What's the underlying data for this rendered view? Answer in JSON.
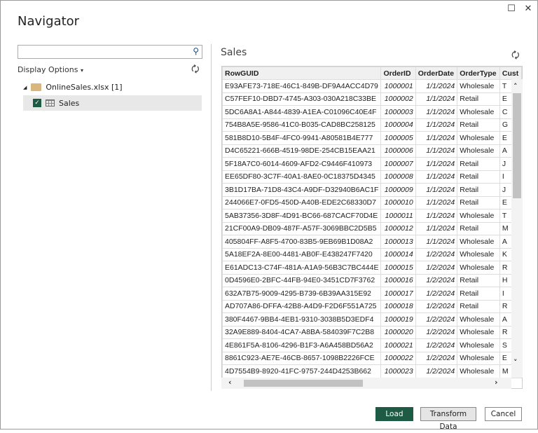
{
  "window": {
    "title": "Navigator",
    "maximize_icon": "☐",
    "close_icon": "✕"
  },
  "left": {
    "search_placeholder": "",
    "display_options": "Display Options",
    "tree": {
      "file": "OnlineSales.xlsx [1]",
      "sheet": "Sales"
    }
  },
  "preview": {
    "title": "Sales",
    "columns": [
      "RowGUID",
      "OrderID",
      "OrderDate",
      "OrderType",
      "Cust"
    ],
    "rows": [
      [
        "E93AFE73-718E-46C1-849B-DF9A4ACC4D79",
        "1000001",
        "1/1/2024",
        "Wholesale",
        "T"
      ],
      [
        "C57FEF10-DBD7-4745-A303-030A218C33BE",
        "1000002",
        "1/1/2024",
        "Retail",
        "E"
      ],
      [
        "5DC6A8A1-A844-4839-A1EA-C01096C40E4F",
        "1000003",
        "1/1/2024",
        "Wholesale",
        "C"
      ],
      [
        "754B8A5E-9586-41C0-B035-CAD8BC258125",
        "1000004",
        "1/1/2024",
        "Retail",
        "G"
      ],
      [
        "581B8D10-5B4F-4FC0-9941-A80581B4E777",
        "1000005",
        "1/1/2024",
        "Wholesale",
        "E"
      ],
      [
        "D4C65221-666B-4519-98DE-254CB15EAA21",
        "1000006",
        "1/1/2024",
        "Wholesale",
        "A"
      ],
      [
        "5F18A7C0-6014-4609-AFD2-C9446F410973",
        "1000007",
        "1/1/2024",
        "Retail",
        "J"
      ],
      [
        "EE65DF80-3C7F-40A1-8AE0-0C18375D4345",
        "1000008",
        "1/1/2024",
        "Retail",
        "I"
      ],
      [
        "3B1D17BA-71D8-43C4-A9DF-D32940B6AC1F",
        "1000009",
        "1/1/2024",
        "Retail",
        "J"
      ],
      [
        "244066E7-0FD5-450D-A40B-EDE2C68330D7",
        "1000010",
        "1/1/2024",
        "Retail",
        "E"
      ],
      [
        "5AB37356-3D8F-4D91-BC66-687CACF70D4E",
        "1000011",
        "1/1/2024",
        "Wholesale",
        "T"
      ],
      [
        "21CF00A9-DB09-487F-A57F-3069BBC2D5B5",
        "1000012",
        "1/1/2024",
        "Retail",
        "M"
      ],
      [
        "405804FF-A8F5-4700-83B5-9EB69B1D08A2",
        "1000013",
        "1/1/2024",
        "Wholesale",
        "A"
      ],
      [
        "5A18EF2A-8E00-4481-AB0F-E438247F7420",
        "1000014",
        "1/2/2024",
        "Wholesale",
        "K"
      ],
      [
        "E61ADC13-C74F-481A-A1A9-56B3C7BC444E",
        "1000015",
        "1/2/2024",
        "Wholesale",
        "R"
      ],
      [
        "0D4596E0-2BFC-44FB-94E0-3451CD7F3762",
        "1000016",
        "1/2/2024",
        "Retail",
        "H"
      ],
      [
        "632A7B75-9009-4295-B739-6B39AA315E92",
        "1000017",
        "1/2/2024",
        "Retail",
        "I"
      ],
      [
        "AD707A86-DFFA-42B8-A4D9-F2D6F551A725",
        "1000018",
        "1/2/2024",
        "Retail",
        "R"
      ],
      [
        "380F4467-9BB4-4EB1-9310-3038B5D3EDF4",
        "1000019",
        "1/2/2024",
        "Wholesale",
        "A"
      ],
      [
        "32A9E889-8404-4CA7-A8BA-584039F7C2B8",
        "1000020",
        "1/2/2024",
        "Wholesale",
        "R"
      ],
      [
        "4E861F5A-8106-4296-B1F3-A6A458BD56A2",
        "1000021",
        "1/2/2024",
        "Wholesale",
        "S"
      ],
      [
        "8861C923-AE7E-46CB-8657-1098B2226FCE",
        "1000022",
        "1/2/2024",
        "Wholesale",
        "E"
      ],
      [
        "4D7554B9-8920-41FC-9757-244D4253B662",
        "1000023",
        "1/2/2024",
        "Wholesale",
        "M"
      ]
    ]
  },
  "buttons": {
    "load": "Load",
    "transform": "Transform Data",
    "cancel": "Cancel"
  },
  "colors": {
    "accent": "#1e5b45"
  }
}
